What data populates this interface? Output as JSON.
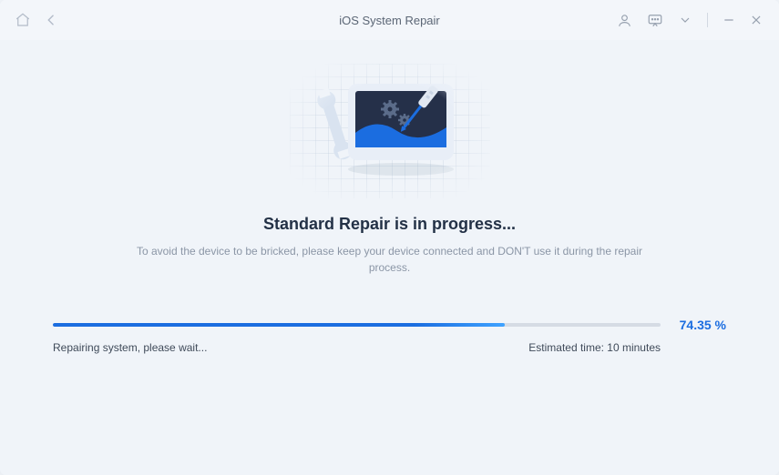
{
  "titlebar": {
    "title": "iOS System Repair",
    "icons": {
      "home": "home-icon",
      "back": "back-arrow-icon",
      "user": "user-icon",
      "chat": "chat-icon",
      "chevron": "chevron-down-icon",
      "minimize": "minimize-icon",
      "close": "close-icon"
    }
  },
  "main": {
    "heading": "Standard Repair is in progress...",
    "subtext": "To avoid the device to be bricked, please keep your device connected and DON'T use it during the repair process."
  },
  "progress": {
    "percent_value": 74.35,
    "percent_label": "74.35 %",
    "status_text": "Repairing system, please wait...",
    "eta_text": "Estimated time: 10 minutes"
  },
  "colors": {
    "accent": "#1b6de0",
    "text_dark": "#233146",
    "text_muted": "#8b96a6",
    "bg": "#f0f4f9"
  }
}
